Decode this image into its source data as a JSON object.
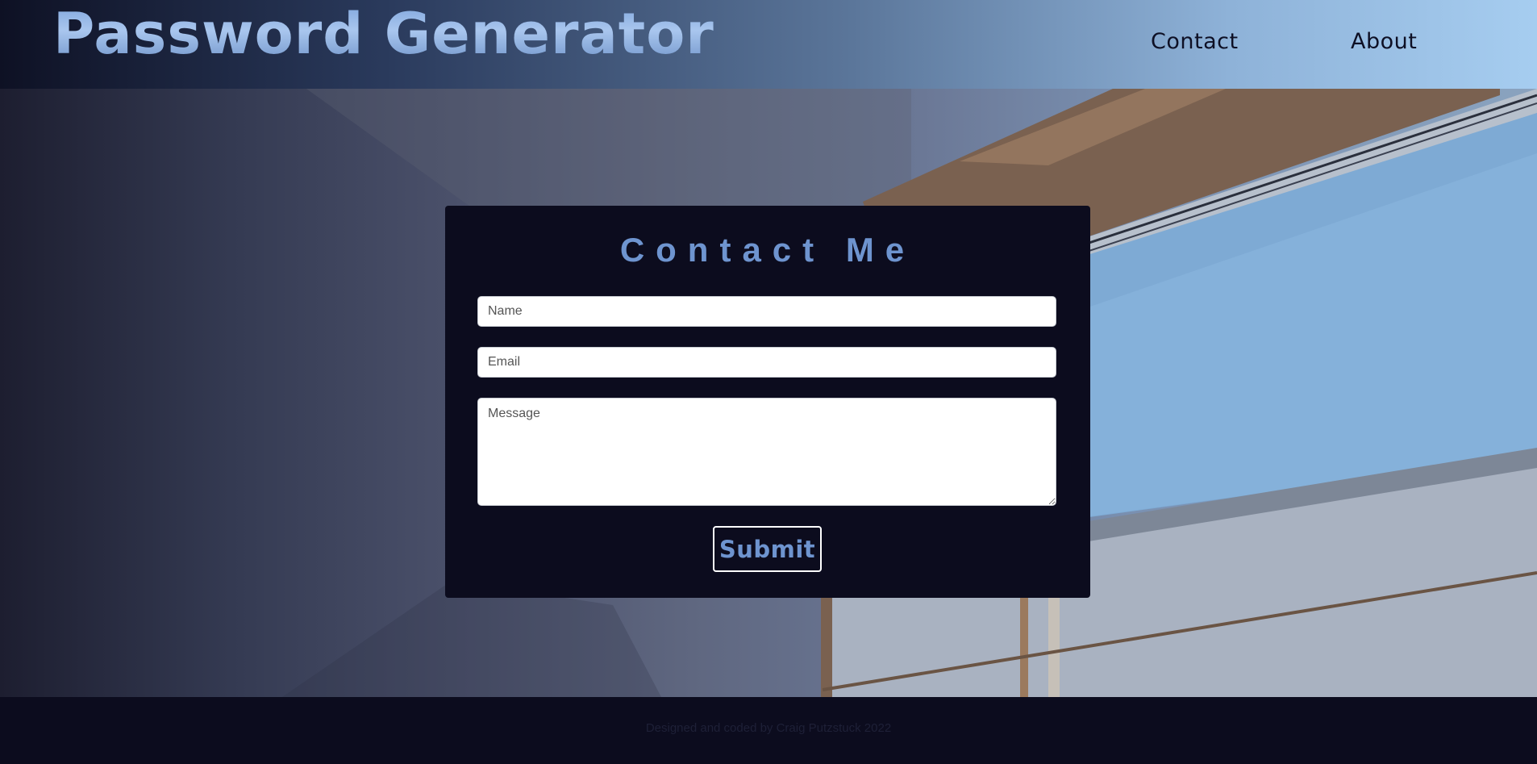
{
  "header": {
    "brand": "Password Generator",
    "nav": [
      {
        "label": "Contact"
      },
      {
        "label": "About"
      }
    ]
  },
  "contact_form": {
    "title": "Contact Me",
    "name_placeholder": "Name",
    "email_placeholder": "Email",
    "message_placeholder": "Message",
    "submit_label": "Submit"
  },
  "footer": {
    "credit": "Designed and coded by Craig Putzstuck 2022"
  },
  "colors": {
    "accent": "#6e94cf",
    "dark": "#0c0c1e",
    "sky": "#8ab6e0"
  }
}
